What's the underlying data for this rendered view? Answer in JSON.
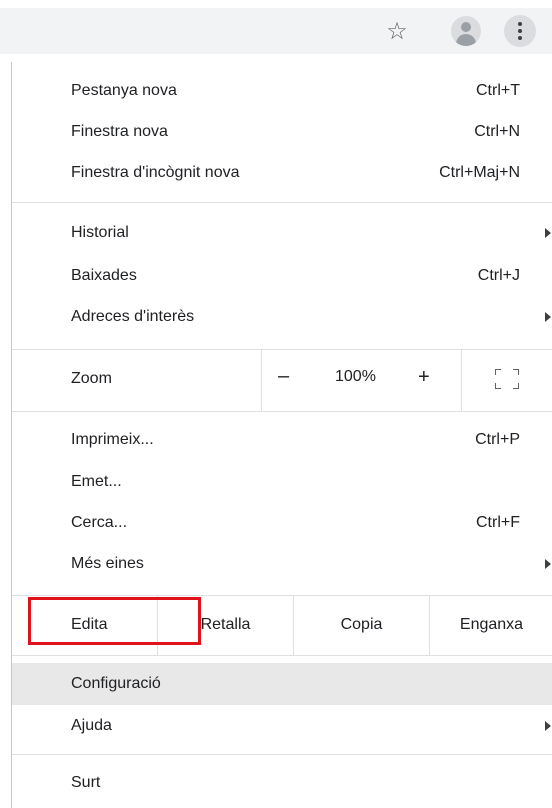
{
  "toolbar": {
    "star_icon": "star-outline-icon",
    "avatar_icon": "profile-avatar-icon",
    "menu_icon": "three-dot-menu-icon"
  },
  "menu": {
    "new_tab": {
      "label": "Pestanya nova",
      "shortcut": "Ctrl+T"
    },
    "new_window": {
      "label": "Finestra nova",
      "shortcut": "Ctrl+N"
    },
    "incognito": {
      "label": "Finestra d'incògnit nova",
      "shortcut": "Ctrl+Maj+N"
    },
    "history": {
      "label": "Historial"
    },
    "downloads": {
      "label": "Baixades",
      "shortcut": "Ctrl+J"
    },
    "bookmarks": {
      "label": "Adreces d'interès"
    },
    "zoom": {
      "label": "Zoom",
      "minus": "–",
      "value": "100%",
      "plus": "+"
    },
    "print": {
      "label": "Imprimeix...",
      "shortcut": "Ctrl+P"
    },
    "cast": {
      "label": "Emet..."
    },
    "find": {
      "label": "Cerca...",
      "shortcut": "Ctrl+F"
    },
    "more_tools": {
      "label": "Més eines"
    },
    "edit": {
      "label": "Edita",
      "cut": "Retalla",
      "copy": "Copia",
      "paste": "Enganxa"
    },
    "settings": {
      "label": "Configuració"
    },
    "help": {
      "label": "Ajuda"
    },
    "exit": {
      "label": "Surt"
    }
  },
  "colors": {
    "highlight_border": "#e0131c",
    "hover_bg": "#e8e8e8"
  }
}
